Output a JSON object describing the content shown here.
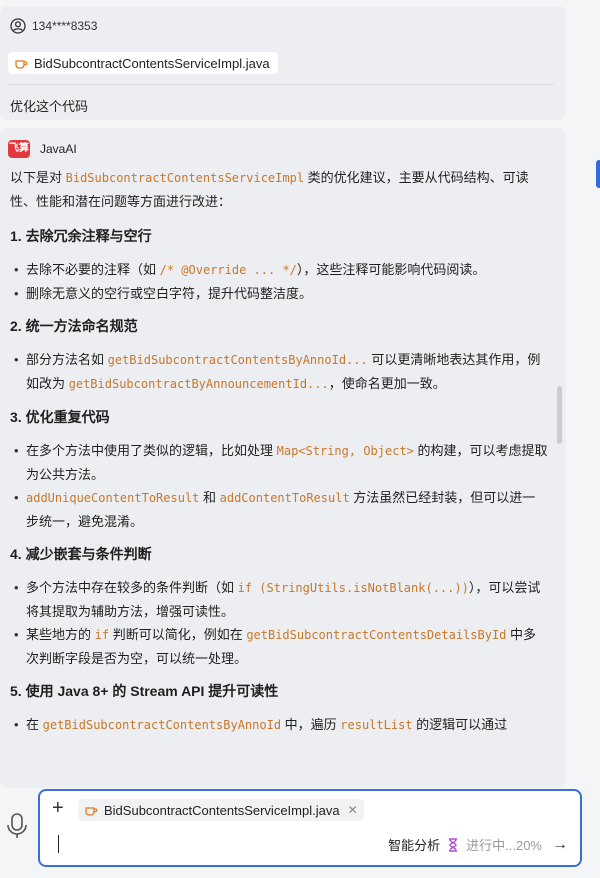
{
  "user": {
    "name": "134****8353",
    "file_name": "BidSubcontractContentsServiceImpl.java",
    "message": "优化这个代码"
  },
  "assistant": {
    "name": "JavaAI",
    "logo_text": "飞算",
    "intro": {
      "pre": "以下是对 ",
      "code": "BidSubcontractContentsServiceImpl",
      "post": " 类的优化建议，主要从代码结构、可读性、性能和潜在问题等方面进行改进："
    },
    "sections": [
      {
        "title": "1. 去除冗余注释与空行",
        "items": [
          [
            "去除不必要的注释（如 ",
            {
              "code": "/* @Override ... */"
            },
            "），这些注释可能影响代码阅读。"
          ],
          [
            "删除无意义的空行或空白字符，提升代码整洁度。"
          ]
        ]
      },
      {
        "title": "2. 统一方法命名规范",
        "items": [
          [
            "部分方法名如 ",
            {
              "code": "getBidSubcontractContentsByAnnoId..."
            },
            " 可以更清晰地表达其作用，例如改为 ",
            {
              "code": "getBidSubcontractByAnnouncementId..."
            },
            "，使命名更加一致。"
          ]
        ]
      },
      {
        "title": "3. 优化重复代码",
        "items": [
          [
            "在多个方法中使用了类似的逻辑，比如处理 ",
            {
              "code": "Map<String, Object>"
            },
            " 的构建，可以考虑提取为公共方法。"
          ],
          [
            {
              "code": "addUniqueContentToResult"
            },
            " 和 ",
            {
              "code": "addContentToResult"
            },
            " 方法虽然已经封装，但可以进一步统一，避免混淆。"
          ]
        ]
      },
      {
        "title": "4. 减少嵌套与条件判断",
        "items": [
          [
            "多个方法中存在较多的条件判断（如 ",
            {
              "code": "if (StringUtils.isNotBlank(...))"
            },
            "），可以尝试将其提取为辅助方法，增强可读性。"
          ],
          [
            "某些地方的 ",
            {
              "code": "if"
            },
            " 判断可以简化，例如在 ",
            {
              "code": "getBidSubcontractContentsDetailsById"
            },
            " 中多次判断字段是否为空，可以统一处理。"
          ]
        ]
      },
      {
        "title": "5. 使用 Java 8+ 的 Stream API 提升可读性",
        "items": [
          [
            "在 ",
            {
              "code": "getBidSubcontractContentsByAnnoId"
            },
            " 中，遍历 ",
            {
              "code": "resultList"
            },
            " 的逻辑可以通过"
          ]
        ]
      }
    ]
  },
  "input": {
    "file_name": "BidSubcontractContentsServiceImpl.java",
    "smart_label": "智能分析",
    "progress_text": "进行中...20%"
  }
}
